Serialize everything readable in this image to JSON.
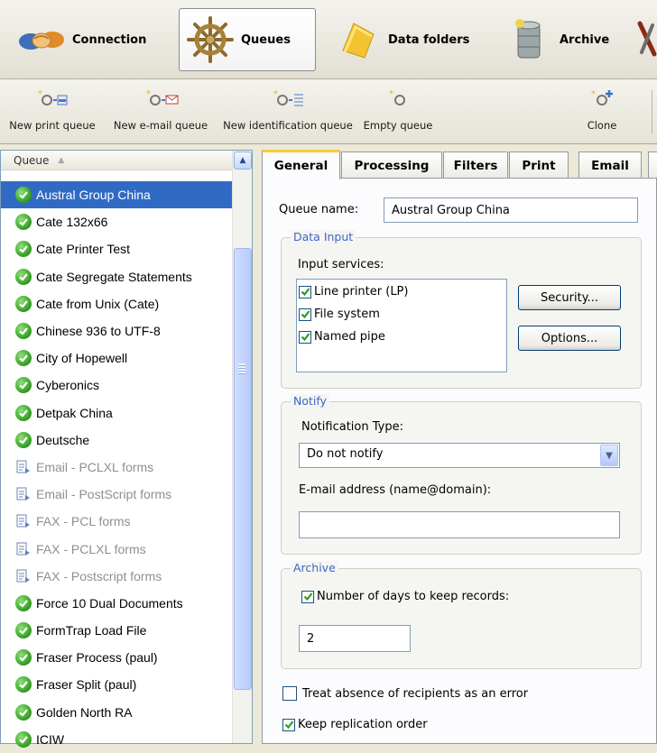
{
  "categories": [
    {
      "label": "Connection",
      "icon": "handshake-icon"
    },
    {
      "label": "Queues",
      "icon": "ship-wheel-icon",
      "active": true
    },
    {
      "label": "Data folders",
      "icon": "folder-icon"
    },
    {
      "label": "Archive",
      "icon": "database-icon"
    }
  ],
  "actions": [
    {
      "label": "New print queue",
      "icon": "new-print-queue-icon"
    },
    {
      "label": "New e-mail queue",
      "icon": "new-email-queue-icon"
    },
    {
      "label": "New identification queue",
      "icon": "new-identification-queue-icon"
    },
    {
      "label": "Empty queue",
      "icon": "empty-queue-icon"
    },
    {
      "label": "Clone",
      "icon": "clone-icon"
    }
  ],
  "queue_list": {
    "header": "Queue",
    "items": [
      {
        "label": "Austral Group China",
        "status": "ok",
        "selected": true
      },
      {
        "label": "Cate 132x66",
        "status": "ok"
      },
      {
        "label": "Cate Printer Test",
        "status": "ok"
      },
      {
        "label": "Cate Segregate Statements",
        "status": "ok"
      },
      {
        "label": "Cate from Unix (Cate)",
        "status": "ok"
      },
      {
        "label": "Chinese 936 to UTF-8",
        "status": "ok"
      },
      {
        "label": "City of Hopewell",
        "status": "ok"
      },
      {
        "label": "Cyberonics",
        "status": "ok"
      },
      {
        "label": "Detpak China",
        "status": "ok"
      },
      {
        "label": "Deutsche",
        "status": "ok"
      },
      {
        "label": "Email - PCLXL forms",
        "status": "disabled"
      },
      {
        "label": "Email - PostScript forms",
        "status": "disabled"
      },
      {
        "label": "FAX - PCL forms",
        "status": "disabled"
      },
      {
        "label": "FAX - PCLXL forms",
        "status": "disabled"
      },
      {
        "label": "FAX - Postscript forms",
        "status": "disabled"
      },
      {
        "label": "Force 10 Dual Documents",
        "status": "ok"
      },
      {
        "label": "FormTrap Load File",
        "status": "ok"
      },
      {
        "label": "Fraser Process (paul)",
        "status": "ok"
      },
      {
        "label": "Fraser Split (paul)",
        "status": "ok"
      },
      {
        "label": "Golden North RA",
        "status": "ok"
      },
      {
        "label": "ICIW",
        "status": "ok"
      }
    ]
  },
  "tabs": [
    "General",
    "Processing",
    "Filters",
    "Print",
    "Email"
  ],
  "general": {
    "queue_name_label": "Queue name:",
    "queue_name_value": "Austral Group China",
    "data_input": {
      "title": "Data Input",
      "services_label": "Input services:",
      "services": [
        {
          "label": "Line printer (LP)",
          "checked": true
        },
        {
          "label": "File system",
          "checked": true
        },
        {
          "label": "Named pipe",
          "checked": true
        }
      ],
      "security_button": "Security...",
      "options_button": "Options..."
    },
    "notify": {
      "title": "Notify",
      "type_label": "Notification Type:",
      "type_value": "Do not notify",
      "email_label": "E-mail address (name@domain):",
      "email_value": ""
    },
    "archive": {
      "title": "Archive",
      "days_label": "Number of days to keep records:",
      "days_checked": true,
      "days_value": "2"
    },
    "treat_absence_label": "Treat absence of recipients as an error",
    "treat_absence_checked": false,
    "keep_order_label": "Keep replication order",
    "keep_order_checked": true
  }
}
